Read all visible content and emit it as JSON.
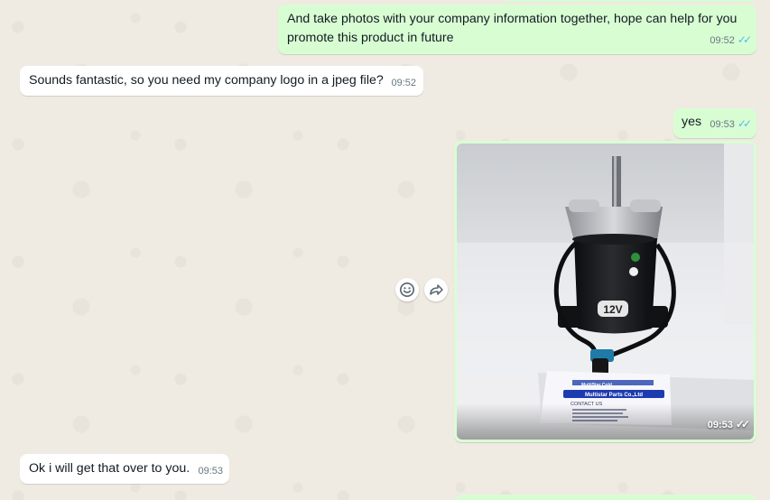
{
  "messages": [
    {
      "direction": "outgoing",
      "text": "And take photos with your company information together, hope can help for you promote this product in future",
      "time": "09:52",
      "status": "read"
    },
    {
      "direction": "incoming",
      "text": "Sounds fantastic, so you need my company logo in a jpeg file?",
      "time": "09:52"
    },
    {
      "direction": "outgoing",
      "text": "yes",
      "time": "09:53",
      "status": "read"
    },
    {
      "direction": "outgoing",
      "type": "image",
      "time": "09:53",
      "status": "read",
      "image": {
        "motor_label": "12V",
        "card_brand": "MultiStar Cold",
        "card_company": "Multistar Parts Co.,Ltd",
        "card_heading": "CONTACT US"
      }
    },
    {
      "direction": "incoming",
      "text": "Ok i will get that over to you.",
      "time": "09:53"
    }
  ],
  "actions": {
    "react_icon": "emoji-icon",
    "forward_icon": "forward-icon"
  },
  "colors": {
    "outgoing_bubble": "#d9fdd3",
    "incoming_bubble": "#ffffff",
    "read_ticks": "#53bdeb",
    "background": "#efeae2"
  }
}
